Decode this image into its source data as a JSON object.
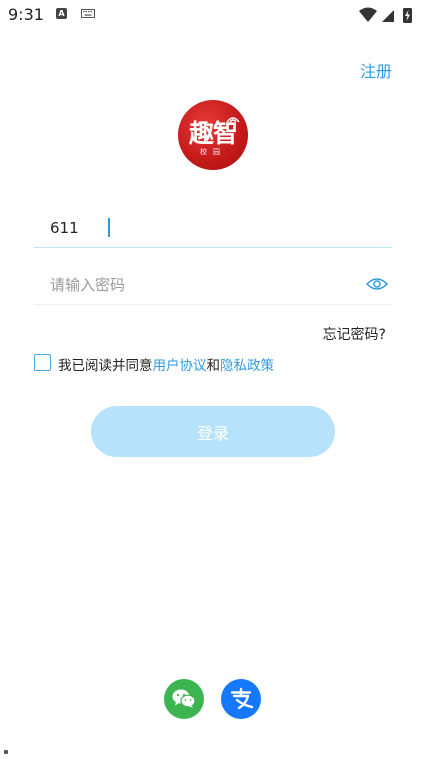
{
  "status_bar": {
    "time": "9:31",
    "notification_icon": "A",
    "keyboard_icon": "keyboard-icon",
    "wifi_icon": "wifi-icon",
    "signal_icon": "signal-icon",
    "battery_icon": "battery-charging-icon"
  },
  "header": {
    "register_label": "注册"
  },
  "logo": {
    "title": "趣智",
    "subtitle": "校园",
    "color": "#c41919"
  },
  "form": {
    "account_value": "611",
    "password_placeholder": "请输入密码",
    "password_toggle_icon": "eye-icon",
    "forgot_label": "忘记密码?",
    "agreement": {
      "prefix": "我已阅读并同意",
      "user_agreement": "用户协议",
      "and": "和",
      "privacy_policy": "隐私政策",
      "checked": false
    },
    "login_label": "登录"
  },
  "third_party": {
    "wechat_icon": "wechat-icon",
    "alipay_icon": "alipay-icon"
  },
  "colors": {
    "accent": "#2d9be0",
    "login_button": "#b6e2fb",
    "wechat": "#3cb551",
    "alipay": "#1677ff"
  }
}
